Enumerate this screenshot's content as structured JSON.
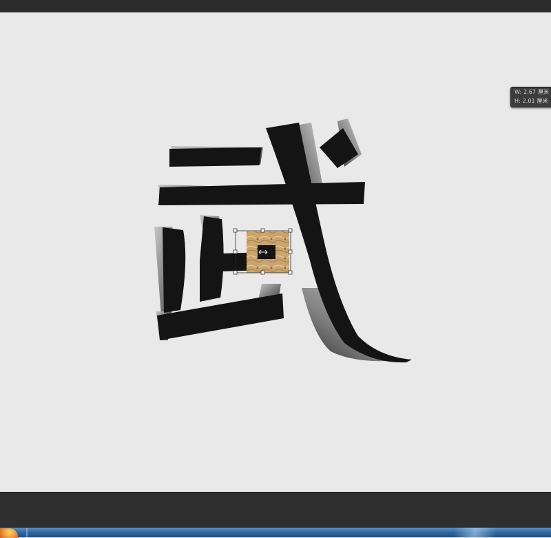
{
  "info_tooltip": {
    "width_label": "W:",
    "width_value": "2.67",
    "width_unit": "厘米",
    "height_label": "H:",
    "height_value": "2.01",
    "height_unit": "厘米"
  },
  "colors": {
    "canvas_bg": "#e9e9e9",
    "glyph_fill": "#141414",
    "bevel_light": "#b5b5b5",
    "bevel_mid": "#6a6a6a",
    "texture_fill": "#c9a46c",
    "panel_dark": "#2f2f2f",
    "taskbar_blue": "#2f6aa6"
  },
  "icons": {
    "move_cursor": "move-arrows-icon",
    "start_button": "windows-start-icon"
  }
}
